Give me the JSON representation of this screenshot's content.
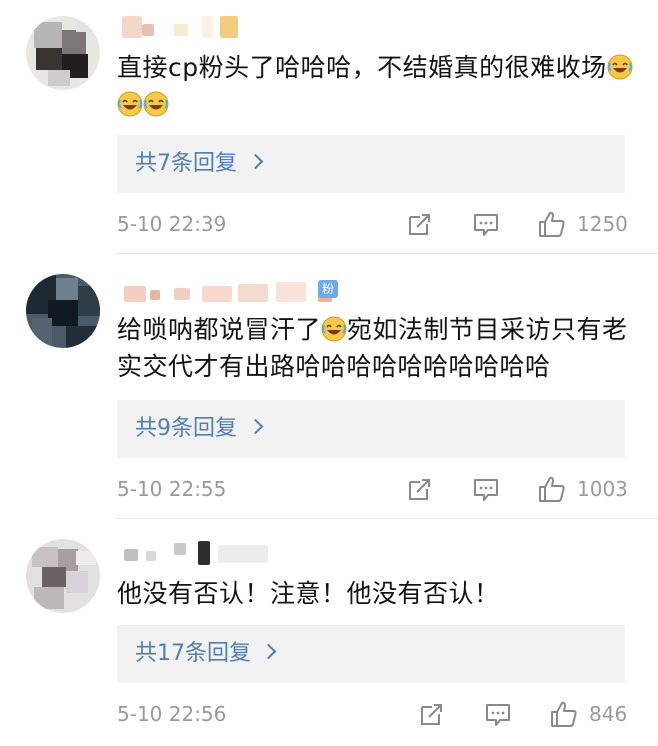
{
  "comments": [
    {
      "text": "直接cp粉头了哈哈哈，不结婚真的很难收场",
      "emoji_count": 3,
      "replies": "共7条回复",
      "time": "5-10 22:39",
      "likes": "1250"
    },
    {
      "text_a": "给唢呐都说冒汗了",
      "text_b": "宛如法制节目采访只有老实交代才有出路哈哈哈哈哈哈哈哈哈哈",
      "badge": "粉",
      "replies": "共9条回复",
      "time": "5-10 22:55",
      "likes": "1003"
    },
    {
      "text": "他没有否认！注意！他没有否认！",
      "replies": "共17条回复",
      "time": "5-10 22:56",
      "likes": "846"
    }
  ],
  "icons": {
    "share": "share-icon",
    "comment": "comment-icon",
    "like": "thumbs-up-icon",
    "emoji": "laughing-emoji-icon"
  },
  "colors": {
    "reply_link": "#4f7fb3",
    "meta_gray": "#9a9a9a",
    "reply_bg": "#f2f2f2",
    "badge_blue": "#6fa8ec"
  }
}
